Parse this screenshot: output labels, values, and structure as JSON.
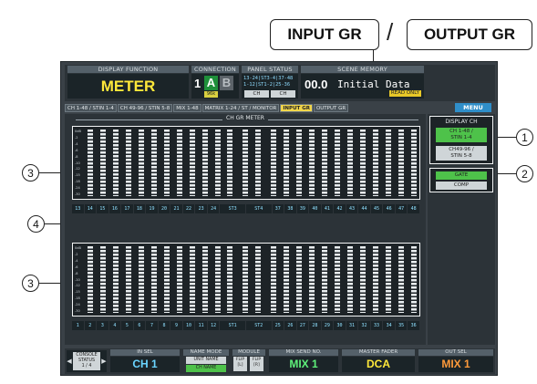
{
  "callouts": {
    "input_gr": "INPUT GR",
    "slash": "/",
    "output_gr": "OUTPUT GR",
    "markers": [
      "1",
      "2",
      "3",
      "4",
      "3"
    ]
  },
  "topbar": {
    "display_function_label": "DISPLAY FUNCTION",
    "display_function_value": "METER",
    "connection_label": "CONNECTION",
    "connection_num": "1",
    "connection_a": "A",
    "connection_b": "B",
    "connection_sub": "96k",
    "panel_status_label": "PANEL STATUS",
    "panel_status_line1": "13-24|ST3-4|37-48",
    "panel_status_line2": "1-12|ST1-2|25-36",
    "panel_btn_left": "CH",
    "panel_btn_right": "CH",
    "scene_memory_label": "SCENE MEMORY",
    "scene_number": "00.0",
    "scene_title": "Initial Data",
    "read_only": "READ ONLY"
  },
  "tabs": [
    {
      "label": "CH 1-48 / STIN 1-4",
      "active": false
    },
    {
      "label": "CH 49-96 / STIN 5-8",
      "active": false
    },
    {
      "label": "MIX 1-48",
      "active": false
    },
    {
      "label": "MATRIX 1-24 / ST / MONITOR",
      "active": false
    },
    {
      "label": "INPUT GR",
      "active": true
    },
    {
      "label": "OUTPUT GR",
      "active": false
    }
  ],
  "menu_label": "MENU",
  "meter": {
    "title": "CH GR METER",
    "scale": [
      "0dB",
      "-2",
      "-4",
      "-6",
      "-8",
      "-10",
      "-12",
      "-15",
      "-18",
      "-24",
      "-30"
    ],
    "top_channels": [
      "13",
      "14",
      "15",
      "16",
      "17",
      "18",
      "19",
      "20",
      "21",
      "22",
      "23",
      "24",
      "ST3",
      "ST4",
      "37",
      "38",
      "39",
      "40",
      "41",
      "42",
      "43",
      "44",
      "45",
      "46",
      "47",
      "48"
    ],
    "bottom_channels": [
      "1",
      "2",
      "3",
      "4",
      "5",
      "6",
      "7",
      "8",
      "9",
      "10",
      "11",
      "12",
      "ST1",
      "ST2",
      "25",
      "26",
      "27",
      "28",
      "29",
      "30",
      "31",
      "32",
      "33",
      "34",
      "35",
      "36"
    ]
  },
  "right_panel": {
    "display_ch_label": "DISPLAY CH",
    "btn1_line1": "CH 1-48 /",
    "btn1_line2": "STIN 1-4",
    "btn2_line1": "CH49-96 /",
    "btn2_line2": "STIN 5-8",
    "gate": "GATE",
    "comp": "COMP"
  },
  "bottombar": {
    "console_status_line1": "CONSOLE",
    "console_status_line2": "STATUS",
    "console_status_line3": "1 / 4",
    "in_sel_label": "IN SEL",
    "in_sel_value": "CH 1",
    "name_mode_label": "NAME MODE",
    "name_mode_unit": "UNIT NAME",
    "name_mode_ch": "CH NAME",
    "module_label": "MODULE",
    "flip_l_1": "FLIP",
    "flip_l_2": "[L]",
    "flip_r_1": "FLIP",
    "flip_r_2": "[R]",
    "mix_send_label": "MIX SEND NO.",
    "mix_send_value": "MIX 1",
    "master_fader_label": "MASTER FADER",
    "master_fader_value": "DCA",
    "out_sel_label": "OUT SEL",
    "out_sel_value": "MIX 1"
  }
}
